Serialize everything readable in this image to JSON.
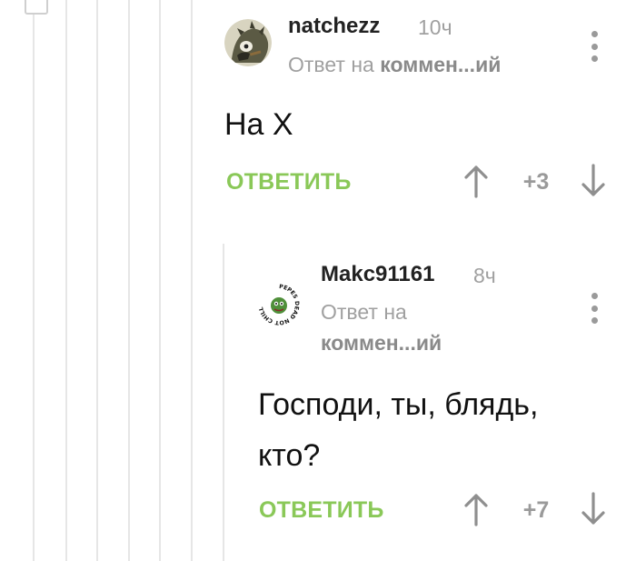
{
  "comment1": {
    "username": "natchezz",
    "time": "10ч",
    "reply_prefix": "Ответ на",
    "reply_target": "коммен...ий",
    "body": "На Х",
    "reply_label": "ОТВЕТИТЬ",
    "score": "+3"
  },
  "comment2": {
    "username": "Makc91161",
    "time": "8ч",
    "reply_prefix": "Ответ на",
    "reply_target": "коммен...ий",
    "body_line1": "Господи, ты, блядь,",
    "body_line2": "кто?",
    "reply_label": "ОТВЕТИТЬ",
    "score": "+7",
    "avatar_ring_text": "PEPES DEAD NOT CHILL"
  },
  "colors": {
    "accent_green": "#8ac858",
    "muted_gray": "#a0a0a0",
    "thread_line": "#e6e6e6"
  },
  "icons": [
    "overflow-menu-icon",
    "upvote-arrow-icon",
    "downvote-arrow-icon"
  ]
}
